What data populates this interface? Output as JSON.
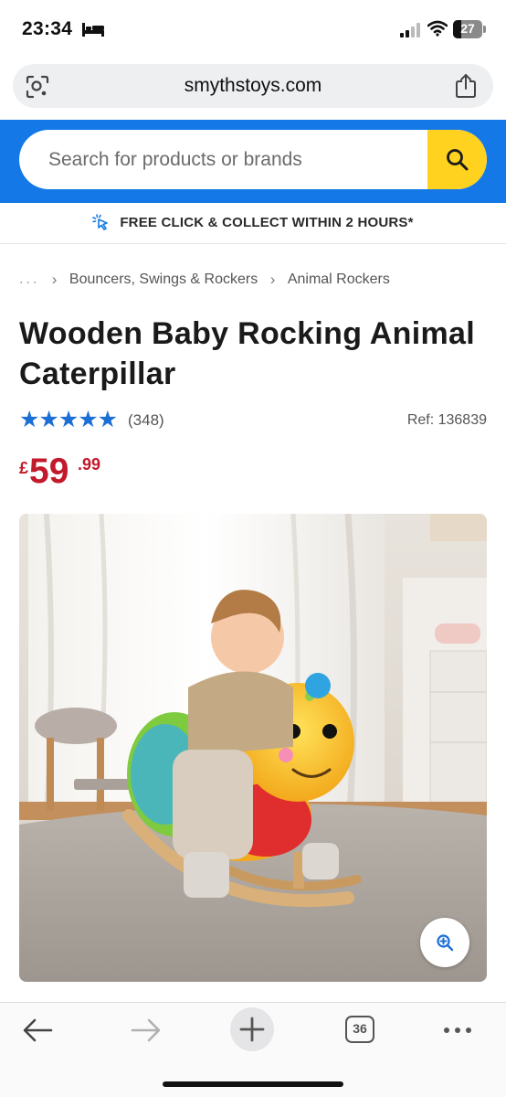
{
  "status_bar": {
    "time": "23:34",
    "battery_level": "27"
  },
  "browser": {
    "url": "smythstoys.com",
    "tab_count": "36"
  },
  "search": {
    "placeholder": "Search for products or brands"
  },
  "promo": {
    "text": "FREE CLICK & COLLECT WITHIN 2 HOURS*"
  },
  "breadcrumb": {
    "ellipsis": "...",
    "items": [
      "Bouncers, Swings & Rockers",
      "Animal Rockers"
    ]
  },
  "product": {
    "title": "Wooden Baby Rocking Animal Caterpillar",
    "rating": 5,
    "stars": "★★★★★",
    "review_count": "(348)",
    "ref": "Ref: 136839",
    "price_currency": "£",
    "price_main": "59",
    "price_pence": ".99"
  },
  "colors": {
    "brand_blue": "#1479e6",
    "search_yellow": "#ffd21f",
    "price_red": "#c2192b",
    "star_blue": "#1d6fd6"
  },
  "icons": [
    "bed-icon",
    "signal-icon",
    "wifi-icon",
    "battery-icon",
    "lens-icon",
    "share-icon",
    "search-icon",
    "cursor-click-icon",
    "star-icon",
    "zoom-in-icon",
    "back-arrow-icon",
    "forward-arrow-icon",
    "plus-icon",
    "more-dots-icon"
  ]
}
